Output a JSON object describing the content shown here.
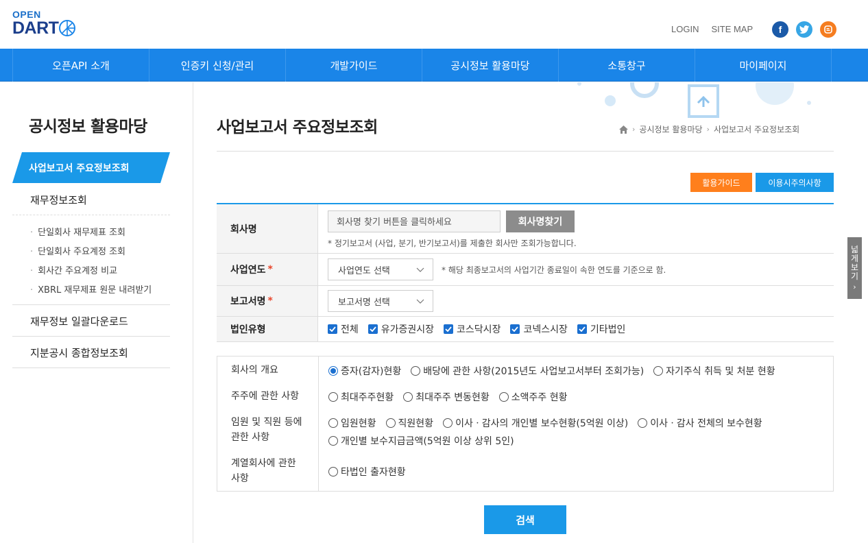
{
  "header": {
    "logo_top": "OPEN",
    "logo_main": "DART",
    "util_links": [
      "LOGIN",
      "SITE MAP"
    ],
    "social": [
      {
        "name": "facebook-icon",
        "glyph": "f",
        "color": "#1b5aa8"
      },
      {
        "name": "twitter-icon",
        "glyph": "t",
        "color": "#37a6e5"
      },
      {
        "name": "blog-icon",
        "glyph": "b",
        "color": "#f57d20"
      }
    ]
  },
  "gnb": [
    "오픈API 소개",
    "인증키 신청/관리",
    "개발가이드",
    "공시정보 활용마당",
    "소통창구",
    "마이페이지"
  ],
  "lnb": {
    "title": "공시정보 활용마당",
    "active": "사업보고서 주요정보조회",
    "item1": "재무정보조회",
    "sub": [
      "단일회사 재무제표 조회",
      "단일회사 주요계정 조회",
      "회사간 주요계정 비교",
      "XBRL 재무제표 원문 내려받기"
    ],
    "item2": "재무정보 일괄다운로드",
    "item3": "지분공시 종합정보조회"
  },
  "page": {
    "title": "사업보고서 주요정보조회",
    "breadcrumb": [
      "공시정보 활용마당",
      "사업보고서 주요정보조회"
    ],
    "btn_guide": "활용가이드",
    "btn_notice": "이용시주의사항",
    "side_tab": [
      "넓",
      "게",
      "보",
      "기"
    ]
  },
  "form": {
    "company_label": "회사명",
    "company_placeholder": "회사명 찾기 버튼을 클릭하세요",
    "company_button": "회사명찾기",
    "company_note": "* 정기보고서 (사업, 분기, 반기보고서)를 제출한 회사만 조회가능합니다.",
    "year_label": "사업연도",
    "year_select": "사업연도 선택",
    "year_note": "* 해당 최종보고서의 사업기간 종료일이 속한 연도를 기준으로 함.",
    "report_label": "보고서명",
    "report_select": "보고서명 선택",
    "corp_label": "법인유형",
    "corp_types": [
      "전체",
      "유가증권시장",
      "코스닥시장",
      "코넥스시장",
      "기타법인"
    ]
  },
  "options": {
    "g1_label": "회사의 개요",
    "g1": [
      "증자(감자)현황",
      "배당에 관한 사항(2015년도 사업보고서부터 조회가능)",
      "자기주식 취득 및 처분 현황"
    ],
    "g2_label": "주주에 관한 사항",
    "g2": [
      "최대주주현황",
      "최대주주 변동현황",
      "소액주주 현황"
    ],
    "g3_label1": "임원 및 직원 등에",
    "g3_label2": "관한 사항",
    "g3": [
      "임원현황",
      "직원현황",
      "이사ㆍ감사의 개인별 보수현황(5억원 이상)",
      "이사ㆍ감사 전체의 보수현황",
      "개인별 보수지급금액(5억원 이상 상위 5인)"
    ],
    "g4_label1": "계열회사에 관한",
    "g4_label2": "사항",
    "g4": [
      "타법인 출자현황"
    ]
  },
  "search_button": "검색"
}
